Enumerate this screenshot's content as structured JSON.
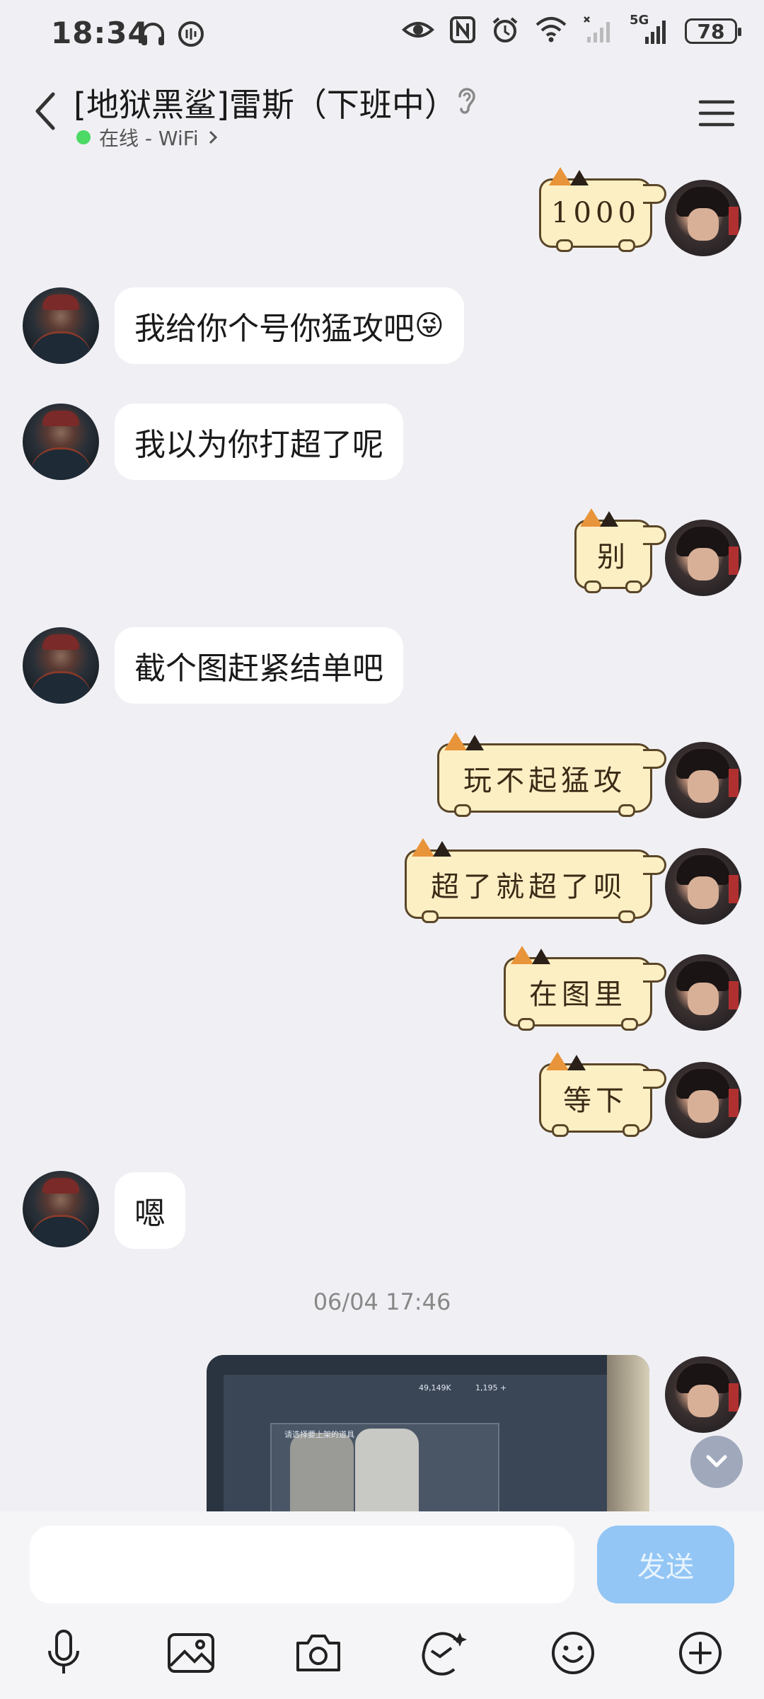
{
  "status_bar": {
    "time": "18:34",
    "network": "5G",
    "battery": "78"
  },
  "header": {
    "title": "[地狱黑鲨]雷斯（下班中）",
    "status": "在线 - WiFi"
  },
  "messages": [
    {
      "from": "me",
      "type": "sticker",
      "text": "1000"
    },
    {
      "from": "other",
      "type": "text",
      "text": "我给你个号你猛攻吧",
      "emoji": "😜"
    },
    {
      "from": "other",
      "type": "text",
      "text": "我以为你打超了呢"
    },
    {
      "from": "me",
      "type": "sticker",
      "text": "别"
    },
    {
      "from": "other",
      "type": "text",
      "text": "截个图赶紧结单吧"
    },
    {
      "from": "me",
      "type": "sticker",
      "text": "玩不起猛攻"
    },
    {
      "from": "me",
      "type": "sticker",
      "text": "超了就超了呗"
    },
    {
      "from": "me",
      "type": "sticker",
      "text": "在图里"
    },
    {
      "from": "me",
      "type": "sticker",
      "text": "等下"
    },
    {
      "from": "other",
      "type": "text",
      "text": "嗯"
    }
  ],
  "timestamp": "06/04 17:46",
  "photo": {
    "title": "请选择要上架的道具",
    "stat1": "49,149K",
    "stat2": "1,195 +"
  },
  "input": {
    "placeholder": "",
    "send_label": "发送"
  },
  "toolbar": [
    "mic-icon",
    "image-icon",
    "camera-icon",
    "ai-icon",
    "emoji-icon",
    "plus-icon"
  ]
}
